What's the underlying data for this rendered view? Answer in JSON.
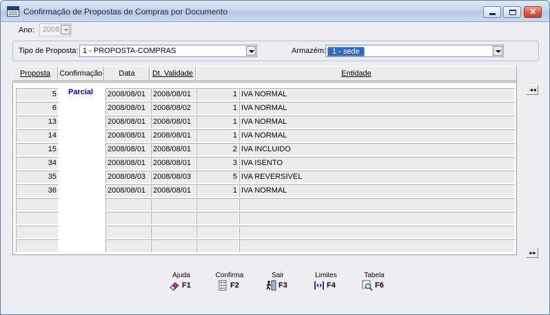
{
  "window": {
    "title": "Confirmação de Propostas de Compras por Documento"
  },
  "form": {
    "ano_label": "Ano:",
    "ano_value": "2008",
    "tipo_label": "Tipo de Proposta:",
    "tipo_value": "1 - PROPOSTA-COMPRAS",
    "armazem_label": "Armazém:",
    "armazem_value": "1 - sede"
  },
  "table": {
    "columns": [
      "Proposta",
      "Confirmação",
      "Data",
      "Dt. Validade",
      "Entidade"
    ],
    "confirm_status": "Parcial",
    "rows": [
      {
        "proposta": "5",
        "data": "2008/08/01",
        "validade": "2008/08/01",
        "entidade_num": "1",
        "entidade": "IVA NORMAL"
      },
      {
        "proposta": "6",
        "data": "2008/08/01",
        "validade": "2008/08/02",
        "entidade_num": "1",
        "entidade": "IVA NORMAL"
      },
      {
        "proposta": "13",
        "data": "2008/08/01",
        "validade": "2008/08/01",
        "entidade_num": "1",
        "entidade": "IVA NORMAL"
      },
      {
        "proposta": "14",
        "data": "2008/08/01",
        "validade": "2008/08/01",
        "entidade_num": "1",
        "entidade": "IVA NORMAL"
      },
      {
        "proposta": "15",
        "data": "2008/08/01",
        "validade": "2008/08/01",
        "entidade_num": "2",
        "entidade": "IVA INCLUIDO"
      },
      {
        "proposta": "34",
        "data": "2008/08/01",
        "validade": "2008/08/01",
        "entidade_num": "3",
        "entidade": "IVA ISENTO"
      },
      {
        "proposta": "35",
        "data": "2008/08/03",
        "validade": "2008/08/03",
        "entidade_num": "5",
        "entidade": "IVA REVERSIVEL"
      },
      {
        "proposta": "36",
        "data": "2008/08/01",
        "validade": "2008/08/01",
        "entidade_num": "1",
        "entidade": "IVA NORMAL"
      },
      {
        "proposta": "",
        "data": "",
        "validade": "",
        "entidade_num": "",
        "entidade": ""
      },
      {
        "proposta": "",
        "data": "",
        "validade": "",
        "entidade_num": "",
        "entidade": ""
      },
      {
        "proposta": "",
        "data": "",
        "validade": "",
        "entidade_num": "",
        "entidade": ""
      },
      {
        "proposta": "",
        "data": "",
        "validade": "",
        "entidade_num": "",
        "entidade": ""
      }
    ]
  },
  "nav": {
    "prev_glyph": "◄◄",
    "next_glyph": "►►"
  },
  "function_keys": [
    {
      "caption": "Ajuda",
      "key": "F1",
      "icon": "help-eraser-icon"
    },
    {
      "caption": "Confirma",
      "key": "F2",
      "icon": "confirm-list-icon"
    },
    {
      "caption": "Sair",
      "key": "F3",
      "icon": "exit-walk-icon"
    },
    {
      "caption": "Limites",
      "key": "F4",
      "icon": "limits-arrows-icon"
    },
    {
      "caption": "Tabela",
      "key": "F6",
      "icon": "table-magnifier-icon"
    }
  ],
  "colors": {
    "selection": "#316ac5",
    "confirm_text": "#0000a8",
    "close_button": "#d8614a"
  }
}
